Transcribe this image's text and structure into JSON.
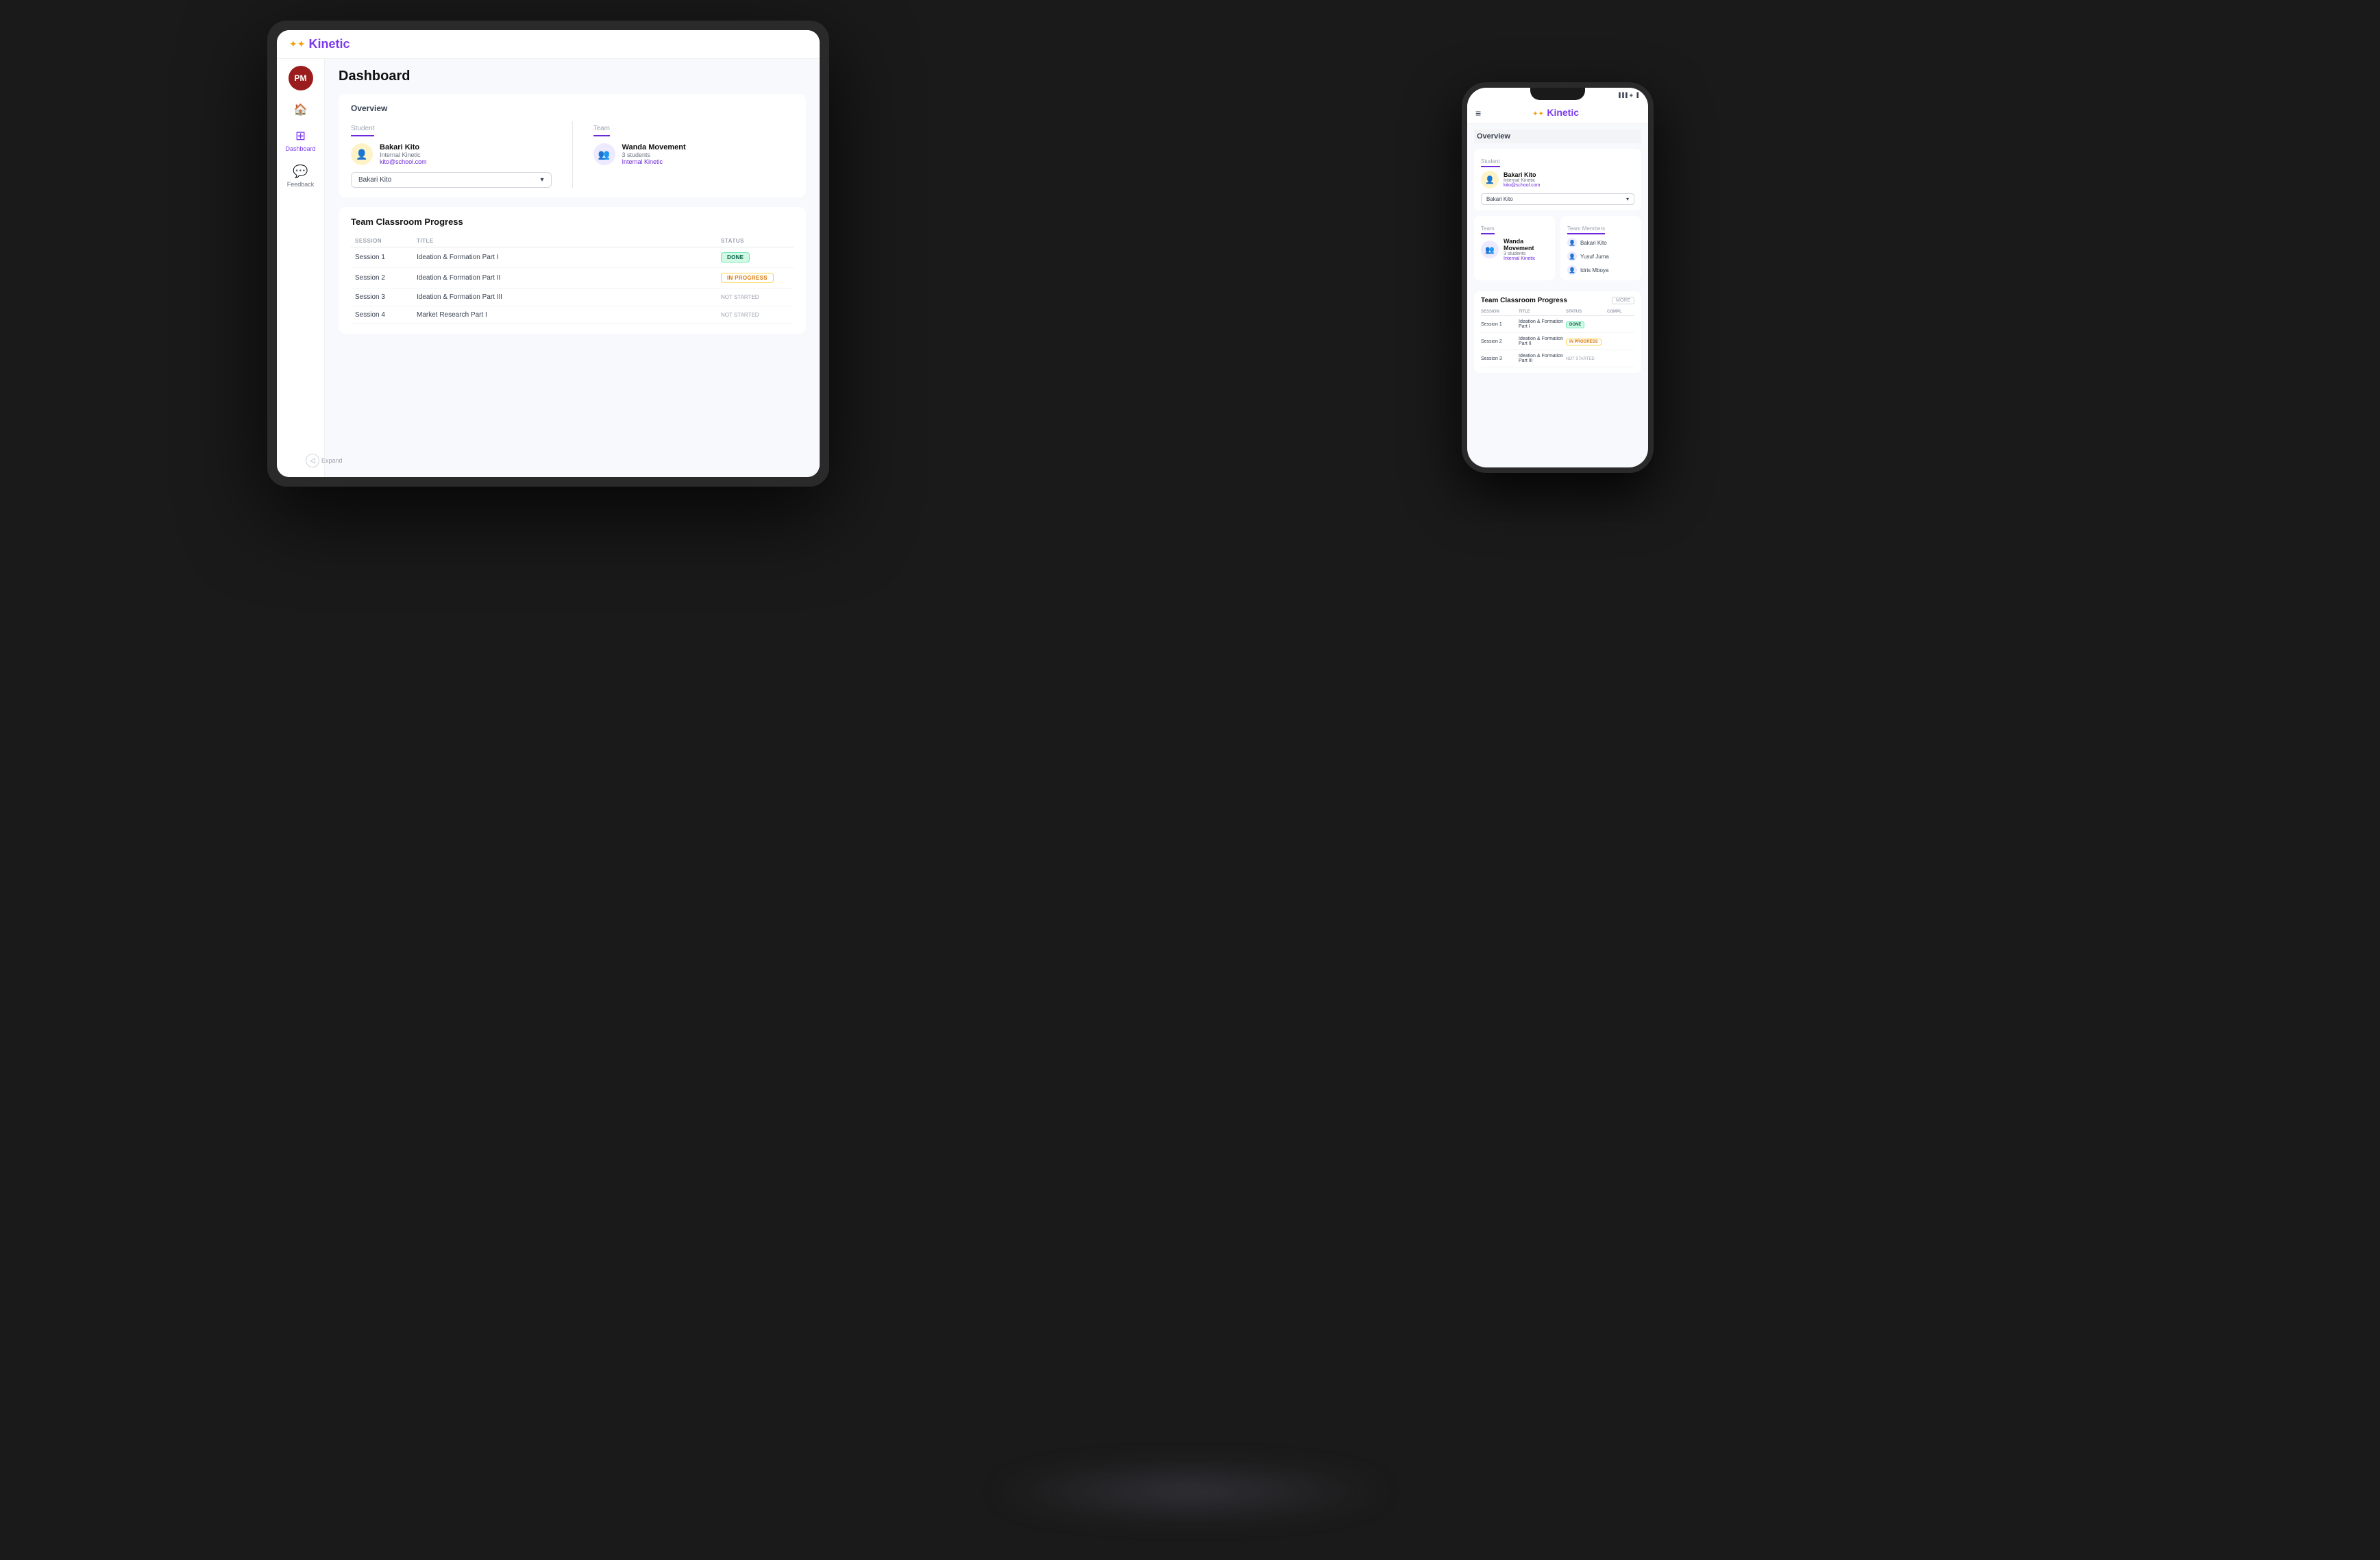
{
  "app": {
    "name": "Kinetic",
    "logo_dots": "✦✦✦"
  },
  "tablet": {
    "avatar_initials": "PM",
    "page_title": "Dashboard",
    "sidebar": {
      "items": [
        {
          "label": "Dashboard",
          "icon": "⊞",
          "active": true
        },
        {
          "label": "Feedback",
          "icon": "💬",
          "active": false
        }
      ]
    },
    "overview": {
      "title": "Overview",
      "student": {
        "label": "Student",
        "name": "Bakari Kito",
        "role": "Internal Kinetic",
        "email": "kito@school.com",
        "dropdown_value": "Bakari Kito"
      },
      "team": {
        "label": "Team",
        "name": "Wanda Movement",
        "students": "3 students",
        "role": "Internal Kinetic"
      }
    },
    "progress": {
      "title": "Team Classroom Progress",
      "columns": [
        "SESSION",
        "TITLE",
        "STATUS"
      ],
      "rows": [
        {
          "session": "Session 1",
          "title": "Ideation & Formation Part I",
          "status": "DONE",
          "status_type": "done"
        },
        {
          "session": "Session 2",
          "title": "Ideation & Formation Part II",
          "status": "IN PROGRESS",
          "status_type": "in-progress"
        },
        {
          "session": "Session 3",
          "title": "Ideation & Formation Part III",
          "status": "NOT STARTED",
          "status_type": "not-started"
        },
        {
          "session": "Session 4",
          "title": "Market Research Part I",
          "status": "NOT STARTED",
          "status_type": "not-started"
        }
      ]
    },
    "collapse_label": "Expand"
  },
  "phone": {
    "overview_title": "Overview",
    "student_label": "Student",
    "student_name": "Bakari Kito",
    "student_role": "Internal Kinetic",
    "student_email": "kito@school.com",
    "dropdown_value": "Bakari Kito",
    "team_label": "Team",
    "team_name": "Wanda Movement",
    "team_students": "3 students",
    "team_role": "Internal Kinetic",
    "team_members_label": "Team Members",
    "members": [
      "Bakari Kito",
      "Yusuf Juma",
      "Idris Mboya"
    ],
    "progress_title": "Team Classroom Progress",
    "progress_columns": [
      "SESSION",
      "TITLE",
      "STATUS",
      "COMPL"
    ],
    "progress_rows": [
      {
        "session": "Session 1",
        "title": "Ideation & Formation Part I",
        "status": "DONE",
        "status_type": "done"
      },
      {
        "session": "Session 2",
        "title": "Ideation & Formation Part II",
        "status": "IN PROGRESS",
        "status_type": "in-progress"
      },
      {
        "session": "Session 3",
        "title": "Ideation & Formation Part III",
        "status": "NOT STARTED",
        "status_type": "not-started"
      }
    ]
  }
}
